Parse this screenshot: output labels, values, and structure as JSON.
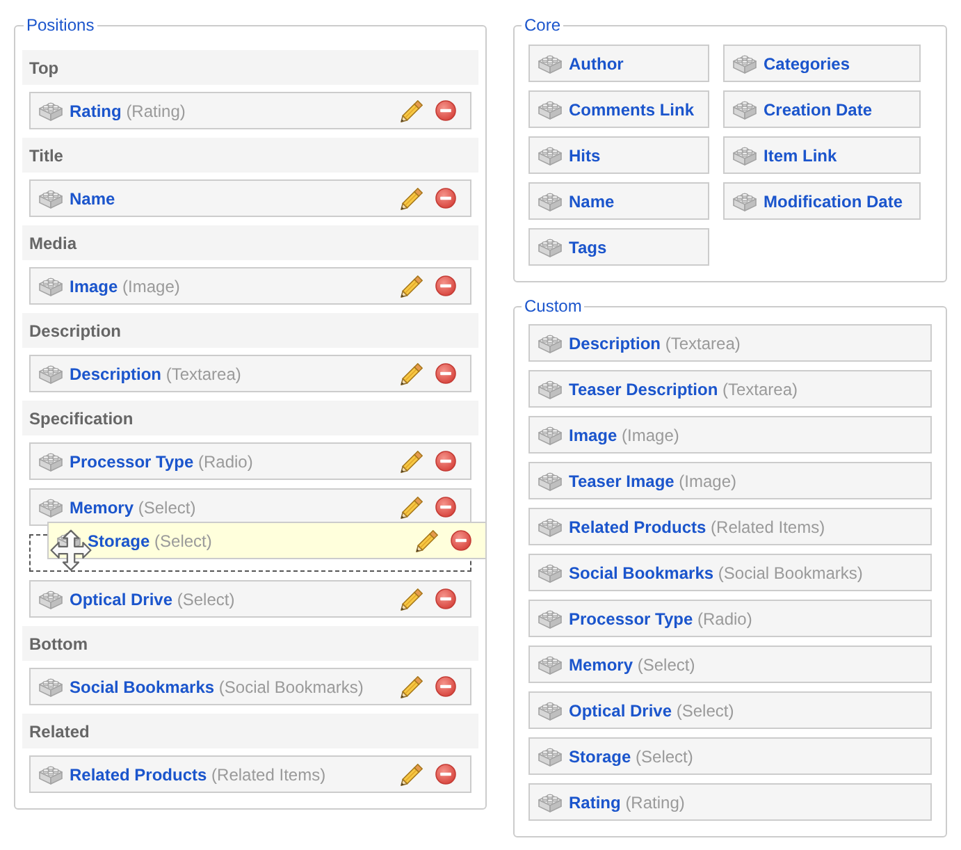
{
  "positions": {
    "title": "Positions",
    "groups": [
      {
        "label": "Top",
        "elements": [
          {
            "name": "Rating",
            "type": "(Rating)",
            "dragging": false
          }
        ]
      },
      {
        "label": "Title",
        "elements": [
          {
            "name": "Name",
            "dragging": false
          }
        ]
      },
      {
        "label": "Media",
        "elements": [
          {
            "name": "Image",
            "type": "(Image)",
            "dragging": false
          }
        ]
      },
      {
        "label": "Description",
        "elements": [
          {
            "name": "Description",
            "type": "(Textarea)",
            "dragging": false
          }
        ]
      },
      {
        "label": "Specification",
        "elements": [
          {
            "name": "Processor Type",
            "type": "(Radio)",
            "dragging": false
          },
          {
            "name": "Memory",
            "type": "(Select)",
            "dragging": false
          },
          {
            "name": "Storage",
            "type": "(Select)",
            "dragging": true
          },
          {
            "name": "Optical Drive",
            "type": "(Select)",
            "dragging": false
          }
        ]
      },
      {
        "label": "Bottom",
        "elements": [
          {
            "name": "Social Bookmarks",
            "type": "(Social Bookmarks)",
            "dragging": false
          }
        ]
      },
      {
        "label": "Related",
        "elements": [
          {
            "name": "Related Products",
            "type": "(Related Items)",
            "dragging": false
          }
        ]
      }
    ]
  },
  "core": {
    "title": "Core",
    "elements": [
      {
        "name": "Author"
      },
      {
        "name": "Categories"
      },
      {
        "name": "Comments Link"
      },
      {
        "name": "Creation Date"
      },
      {
        "name": "Hits"
      },
      {
        "name": "Item Link"
      },
      {
        "name": "Name"
      },
      {
        "name": "Modification Date"
      },
      {
        "name": "Tags"
      }
    ]
  },
  "custom": {
    "title": "Custom",
    "elements": [
      {
        "name": "Description",
        "type": "(Textarea)"
      },
      {
        "name": "Teaser Description",
        "type": "(Textarea)"
      },
      {
        "name": "Image",
        "type": "(Image)"
      },
      {
        "name": "Teaser Image",
        "type": "(Image)"
      },
      {
        "name": "Related Products",
        "type": "(Related Items)"
      },
      {
        "name": "Social Bookmarks",
        "type": "(Social Bookmarks)"
      },
      {
        "name": "Processor Type",
        "type": "(Radio)"
      },
      {
        "name": "Memory",
        "type": "(Select)"
      },
      {
        "name": "Optical Drive",
        "type": "(Select)"
      },
      {
        "name": "Storage",
        "type": "(Select)"
      },
      {
        "name": "Rating",
        "type": "(Rating)"
      }
    ]
  }
}
